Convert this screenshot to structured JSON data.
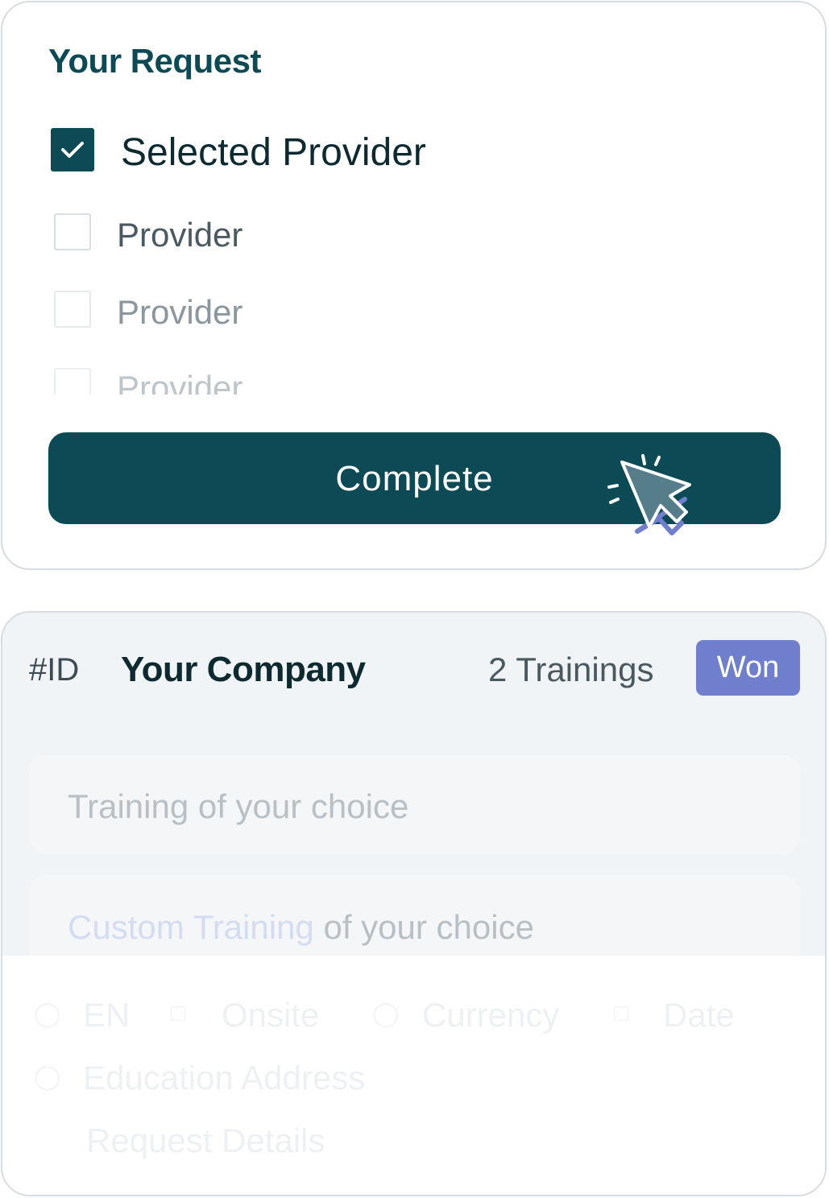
{
  "request_card": {
    "title": "Your Request",
    "options": [
      {
        "label": "Selected Provider",
        "checked": true
      },
      {
        "label": "Provider",
        "checked": false
      },
      {
        "label": "Provider",
        "checked": false
      },
      {
        "label": "Provider",
        "checked": false
      }
    ],
    "button_label": "Complete"
  },
  "company_card": {
    "id": "#ID",
    "company": "Your Company",
    "trainings": "2 Trainings",
    "status": "Won",
    "rows": [
      {
        "text": "Training of your choice"
      },
      {
        "highlight": "Custom Training",
        "text": " of your choice"
      }
    ],
    "meta": {
      "language": "EN",
      "location": "Onsite",
      "currency": "Currency",
      "date": "Date",
      "address": "Education Address",
      "details": "Request Details"
    }
  },
  "colors": {
    "brand": "#0c4a55",
    "status_won": "#6f7fcd",
    "card_bg": "#f1f4f6"
  },
  "icons": [
    "check-icon",
    "cursor-click-icon",
    "globe-icon",
    "building-icon",
    "coin-icon",
    "calendar-icon",
    "location-pin-icon"
  ]
}
